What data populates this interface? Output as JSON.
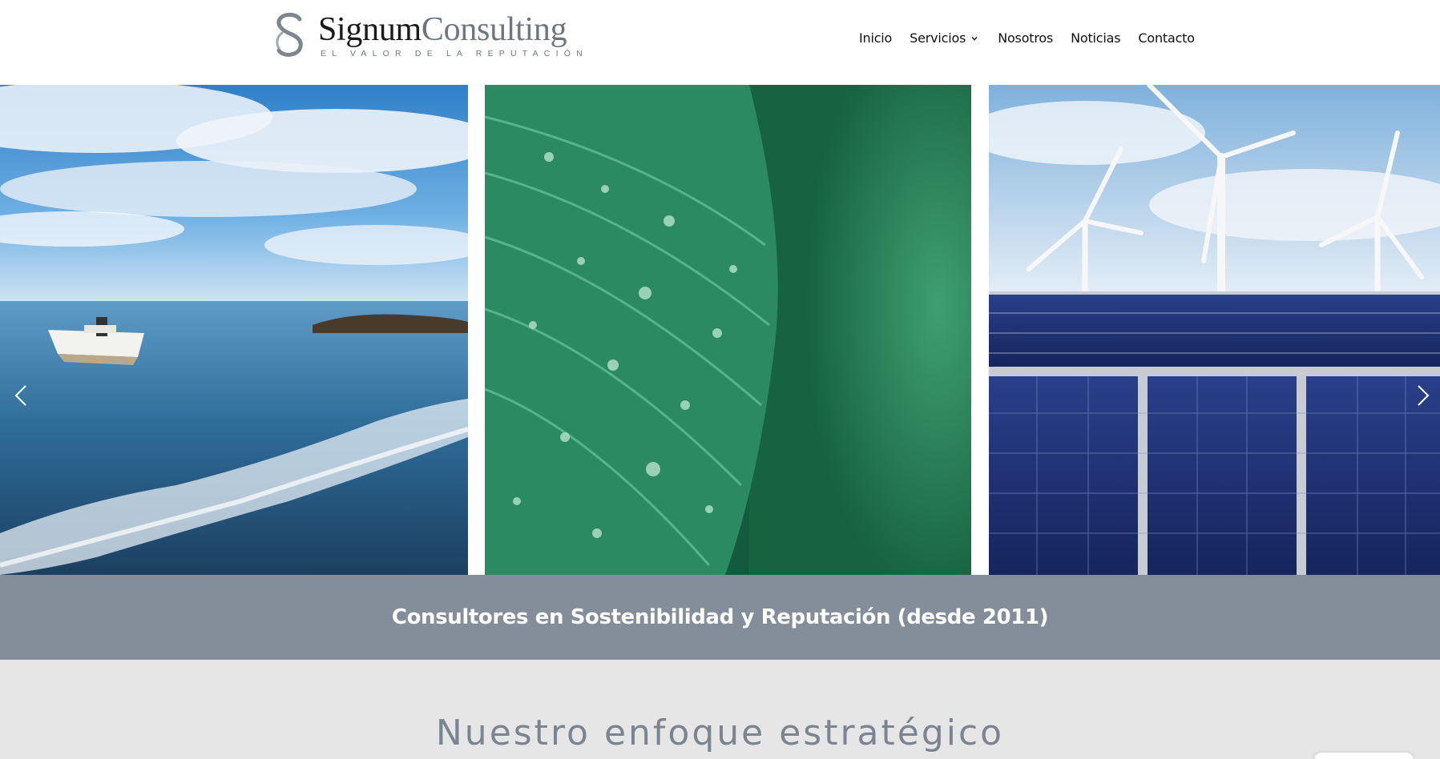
{
  "header": {
    "logo": {
      "word1": "Signum",
      "word2": "Consulting",
      "tagline": "EL VALOR DE LA REPUTACIÓN"
    },
    "nav": [
      {
        "label": "Inicio"
      },
      {
        "label": "Servicios",
        "icon": "chevron-down-icon"
      },
      {
        "label": "Nosotros"
      },
      {
        "label": "Noticias"
      },
      {
        "label": "Contacto"
      }
    ]
  },
  "slider": {
    "slides": [
      {
        "subject": "boat-on-sea"
      },
      {
        "subject": "leaf-with-water-drops"
      },
      {
        "subject": "wind-turbines-and-solar-panels"
      }
    ],
    "prev_icon": "chevron-left-icon",
    "next_icon": "chevron-right-icon"
  },
  "banner": {
    "text": "Consultores en Sostenibilidad y Reputación (desde 2011)"
  },
  "section": {
    "title": "Nuestro enfoque estratégico"
  },
  "colors": {
    "banner_bg": "#848e9a",
    "section_bg": "#e6e6e6",
    "title_color": "#7b8591",
    "logo_grey": "#6e7780"
  }
}
